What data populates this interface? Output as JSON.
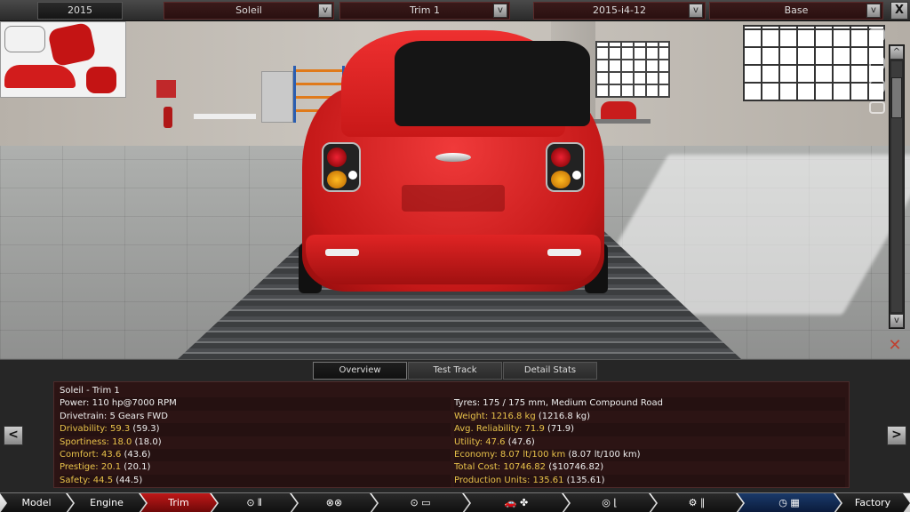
{
  "topbar": {
    "year": "2015",
    "model": "Soleil",
    "trim": "Trim 1",
    "engine": "2015-i4-12",
    "variant": "Base",
    "dropdown_glyph": "v",
    "close_glyph": "X"
  },
  "viewport": {
    "scroll_up_glyph": "^",
    "scroll_down_glyph": "v",
    "tool_glyph": "✕"
  },
  "tabs": [
    {
      "label": "Overview",
      "active": true
    },
    {
      "label": "Test Track",
      "active": false
    },
    {
      "label": "Detail Stats",
      "active": false
    }
  ],
  "stats": {
    "left": [
      {
        "text": "Soleil - Trim 1",
        "highlight": false
      },
      {
        "text": "Power: 110 hp@7000 RPM",
        "highlight": false
      },
      {
        "text": "Drivetrain: 5 Gears FWD",
        "highlight": false
      },
      {
        "label": "Drivability: 59.3",
        "extra": " (59.3)",
        "highlight": true
      },
      {
        "label": "Sportiness: 18.0",
        "extra": " (18.0)",
        "highlight": true
      },
      {
        "label": "Comfort: 43.6",
        "extra": " (43.6)",
        "highlight": true
      },
      {
        "label": "Prestige: 20.1",
        "extra": " (20.1)",
        "highlight": true
      },
      {
        "label": "Safety: 44.5",
        "extra": " (44.5)",
        "highlight": true
      }
    ],
    "right": [
      {
        "text": "",
        "highlight": false
      },
      {
        "text": "Tyres: 175 / 175 mm, Medium Compound Road",
        "highlight": false
      },
      {
        "label": "Weight: 1216.8 kg",
        "extra": " (1216.8 kg)",
        "highlight": true
      },
      {
        "label": "Avg. Reliability: 71.9",
        "extra": " (71.9)",
        "highlight": true
      },
      {
        "label": "Utility: 47.6",
        "extra": " (47.6)",
        "highlight": true
      },
      {
        "label": "Economy: 8.07 lt/100 km",
        "extra": " (8.07 lt/100 km)",
        "highlight": true
      },
      {
        "label": "Total Cost: 10746.82",
        "extra": " ($10746.82)",
        "highlight": true
      },
      {
        "label": "Production Units: 135.61",
        "extra": " (135.61)",
        "highlight": true
      }
    ]
  },
  "nav": {
    "prev_glyph": "<",
    "next_glyph": ">"
  },
  "bottom_nav": {
    "model": "Model",
    "engine": "Engine",
    "trim": "Trim",
    "factory": "Factory",
    "icon_items": [
      {
        "icon": "gearbox-icon",
        "glyphs": "⊙ ⫴"
      },
      {
        "icon": "wheels-icon",
        "glyphs": "⊗⊗"
      },
      {
        "icon": "chassis-icon",
        "glyphs": "⊙ ▭"
      },
      {
        "icon": "body-fan-icon",
        "glyphs": "🚗 ✤"
      },
      {
        "icon": "interior-icon",
        "glyphs": "◎ ⌊"
      },
      {
        "icon": "suspension-icon",
        "glyphs": "⚙ ∥"
      },
      {
        "icon": "test-track-icon",
        "glyphs": "◷ ▦"
      }
    ]
  },
  "colors": {
    "accent": "#c01818",
    "highlight_text": "#e8c24a",
    "panel_bg": "#2c1414"
  }
}
